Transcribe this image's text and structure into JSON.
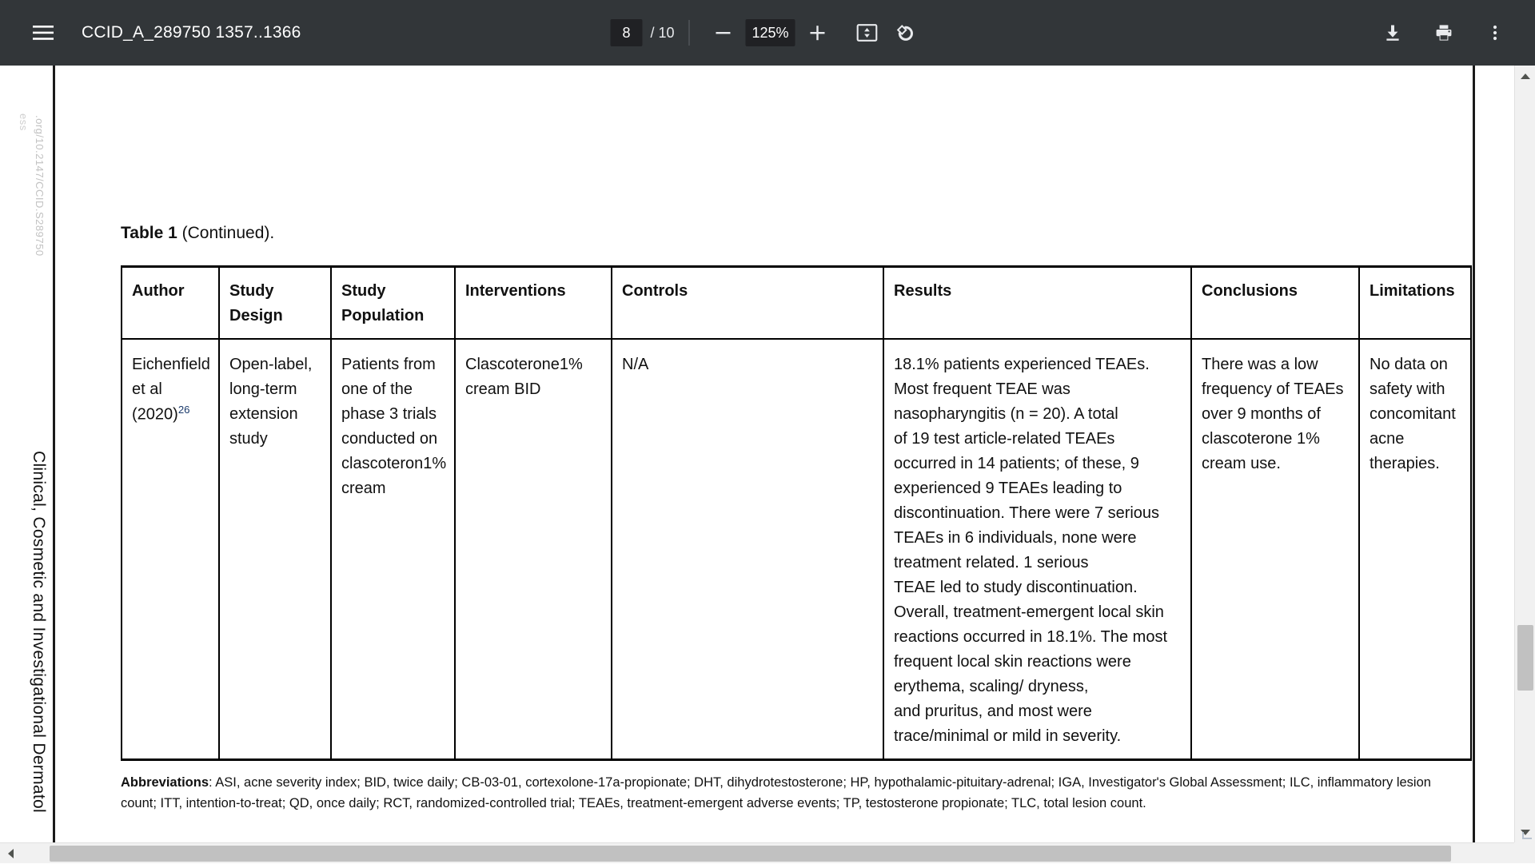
{
  "toolbar": {
    "menu_icon": "hamburger-menu-icon",
    "title": "CCID_A_289750 1357..1366",
    "page_current": "8",
    "page_total": "/ 10",
    "zoom_out_icon": "minus-icon",
    "zoom_level": "125%",
    "zoom_in_icon": "plus-icon",
    "fit_page_icon": "fit-to-page-icon",
    "rotate_icon": "rotate-counterclockwise-icon",
    "download_icon": "download-icon",
    "print_icon": "print-icon",
    "more_icon": "more-vertical-icon",
    "background_color": "#323639",
    "text_color": "#e8eaed",
    "field_background": "#202124"
  },
  "page_margin": {
    "doi_text": ".org/10.2147/CCID.S289750",
    "press_text": "ess",
    "journal_text": "Clinical, Cosmetic and Investigational Dermatol"
  },
  "document": {
    "caption_label": "Table 1",
    "caption_rest": " (Continued).",
    "table": {
      "columns": [
        "Author",
        "Study Design",
        "Study Population",
        "Interventions",
        "Controls",
        "Results",
        "Conclusions",
        "Limitations"
      ],
      "rows": [
        {
          "author": "Eichenfield et al (2020)",
          "author_ref": "26",
          "study_design": "Open-label, long-term extension study",
          "study_population": "Patients from one of the phase 3 trials conducted on clascoteron1% cream",
          "interventions": "Clascoterone1% cream BID",
          "controls": "N/A",
          "results_lines": [
            "18.1% patients experienced TEAEs. Most frequent TEAE was nasopharyngitis (n = 20). A total",
            "of 19 test article-related TEAEs occurred in 14 patients; of these, 9 experienced 9 TEAEs leading to discontinuation. There were 7 serious TEAEs in 6 individuals, none were treatment related. 1 serious",
            "TEAE led to study discontinuation. Overall, treatment-emergent local skin reactions occurred in 18.1%. The most frequent local skin reactions were erythema, scaling/ dryness,",
            "and pruritus, and most were trace/minimal or mild in severity."
          ],
          "conclusions": "There was a low frequency of TEAEs over 9 months of clascoterone 1% cream use.",
          "limitations": "No data on safety with concomitant acne therapies."
        }
      ]
    },
    "abbreviations_label": "Abbreviations",
    "abbreviations_text": ": ASI, acne severity index; BID, twice daily; CB-03-01, cortexolone-17a-propionate; DHT, dihydrotestosterone; HP, hypothalamic-pituitary-adrenal; IGA, Investigator's Global Assessment; ILC, inflammatory lesion count; ITT, intention-to-treat; QD, once daily; RCT, randomized-controlled trial; TEAEs, treatment-emergent adverse events; TP, testosterone propionate; TLC, total lesion count."
  },
  "scrollbars": {
    "vertical_up_icon": "scroll-up-arrow-icon",
    "vertical_down_icon": "scroll-down-arrow-icon",
    "horizontal_left_icon": "scroll-left-arrow-icon",
    "horizontal_right_icon": "scroll-right-arrow-icon",
    "track_color": "#f1f1f1",
    "thumb_color": "#c1c1c1"
  }
}
